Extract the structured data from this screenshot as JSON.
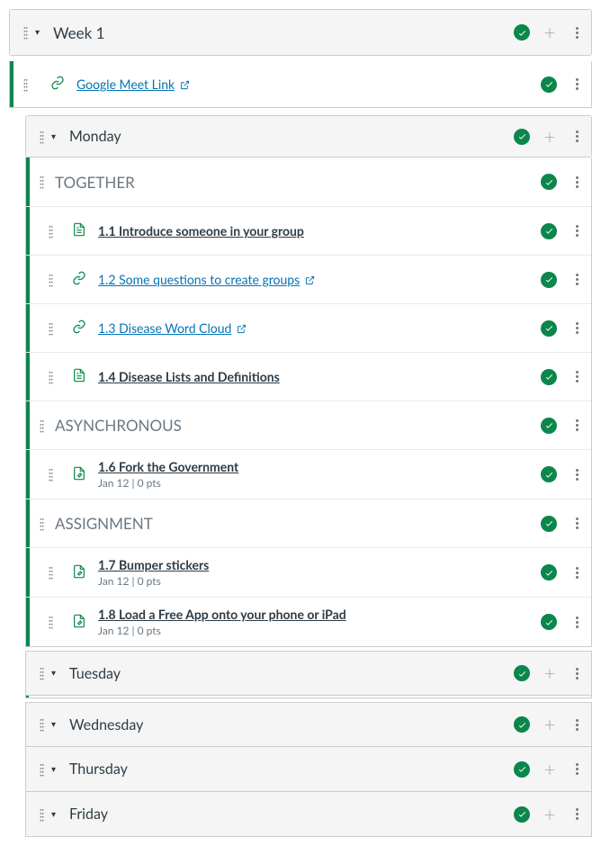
{
  "week": {
    "title": "Week 1"
  },
  "google_meet": {
    "title": "Google Meet Link"
  },
  "monday": {
    "title": "Monday"
  },
  "headings": {
    "together": "TOGETHER",
    "async": "ASYNCHRONOUS",
    "assignment": "ASSIGNMENT"
  },
  "items": {
    "i11": {
      "title": "1.1 Introduce someone in your group"
    },
    "i12": {
      "title": "1.2 Some questions to create groups"
    },
    "i13": {
      "title": "1.3 Disease Word Cloud"
    },
    "i14": {
      "title": "1.4 Disease Lists and Definitions"
    },
    "i16": {
      "title": "1.6 Fork the Government",
      "meta": "Jan 12  |  0 pts"
    },
    "i17": {
      "title": "1.7 Bumper stickers",
      "meta": "Jan 12  |  0 pts"
    },
    "i18": {
      "title": "1.8 Load a Free App onto your phone or iPad",
      "meta": "Jan 12  |  0 pts"
    }
  },
  "days": {
    "tuesday": "Tuesday",
    "wednesday": "Wednesday",
    "thursday": "Thursday",
    "friday": "Friday"
  }
}
